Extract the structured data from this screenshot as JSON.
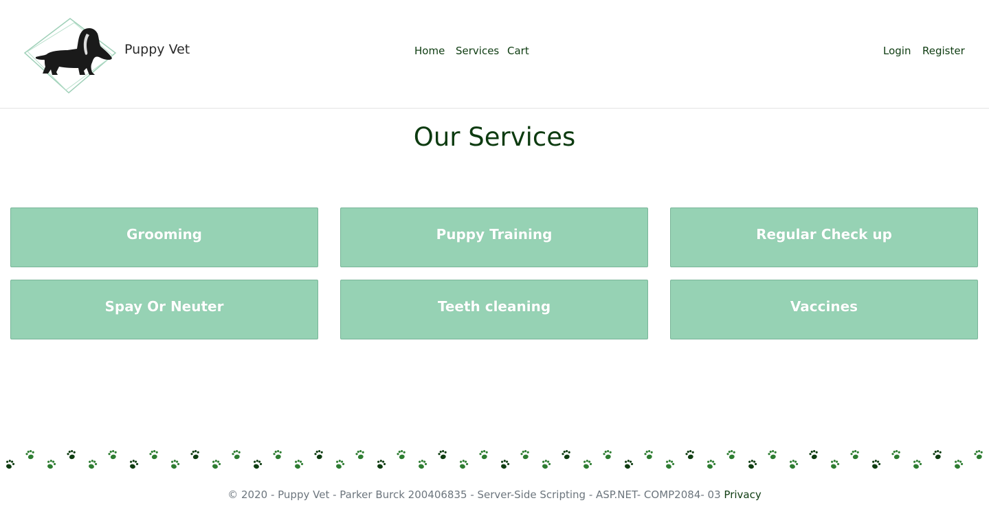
{
  "header": {
    "brand": "Puppy Vet",
    "nav": {
      "home": "Home",
      "services": "Services",
      "cart": "Cart"
    },
    "auth": {
      "login": "Login",
      "register": "Register"
    }
  },
  "main": {
    "title": "Our Services",
    "services": [
      {
        "label": "Grooming"
      },
      {
        "label": "Puppy Training"
      },
      {
        "label": "Regular Check up"
      },
      {
        "label": "Spay Or Neuter"
      },
      {
        "label": "Teeth cleaning"
      },
      {
        "label": "Vaccines"
      }
    ]
  },
  "footer": {
    "text": "© 2020 - Puppy Vet - Parker Burck 200406835 - Server-Side Scripting - ASP.NET- COMP2084- 03",
    "privacy": "Privacy"
  },
  "colors": {
    "accent_green": "#0d3b10",
    "card_green": "#96d2b4",
    "paw_dark": "#0f3d12",
    "paw_mid": "#2e7d32"
  },
  "icons": {
    "logo": "dachshund-logo-icon",
    "paw": "paw-print-icon"
  }
}
